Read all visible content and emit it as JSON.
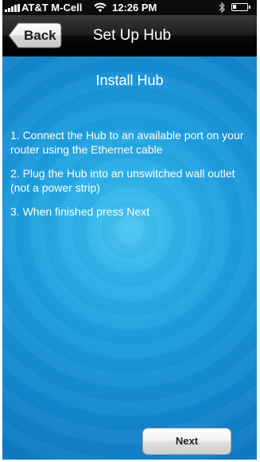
{
  "status_bar": {
    "carrier": "AT&T M-Cell",
    "time": "12:26 PM",
    "icons": [
      "signal-bars-icon",
      "wifi-icon",
      "bluetooth-icon",
      "battery-icon"
    ]
  },
  "nav": {
    "back_label": "Back",
    "title": "Set Up Hub"
  },
  "main": {
    "heading": "Install Hub",
    "steps": [
      "1. Connect the Hub to an available port on your router using the Ethernet cable",
      "2. Plug the Hub into an unswitched wall outlet (not a power strip)",
      "3. When finished press Next"
    ],
    "next_label": "Next"
  },
  "colors": {
    "background_center": "#4fc6f1",
    "background_edge": "#0e78c2",
    "navbar": "#1c1c1c"
  }
}
